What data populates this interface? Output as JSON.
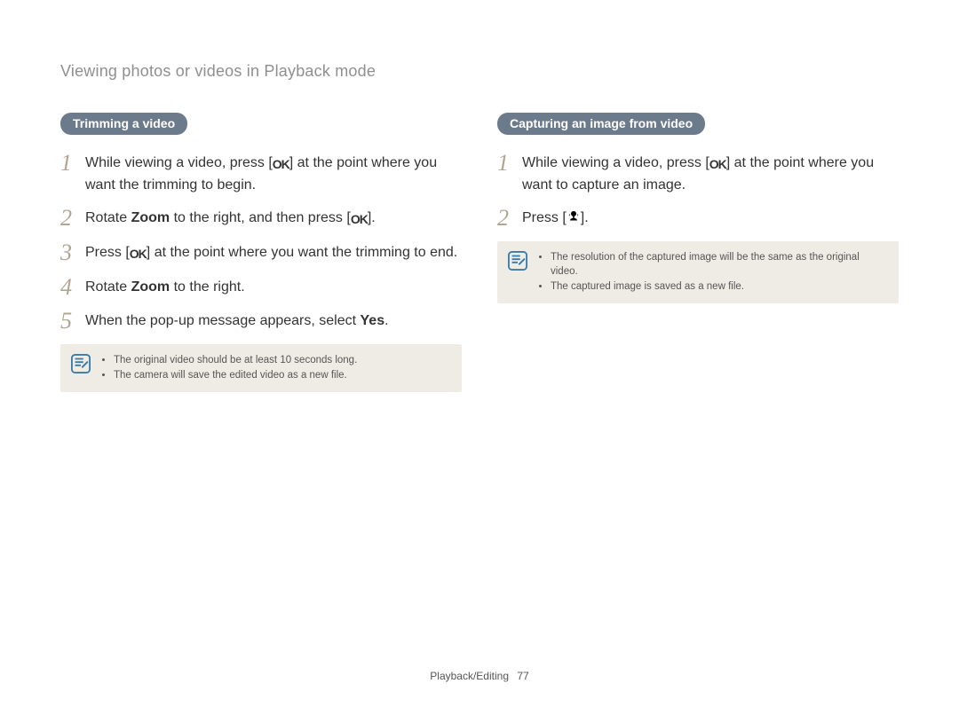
{
  "header": {
    "breadcrumb": "Viewing photos or videos in Playback mode"
  },
  "left": {
    "pill": "Trimming a video",
    "steps": [
      {
        "num": "1",
        "pre": "While viewing a video, press [",
        "icon": "ok",
        "post": "] at the point where you want the trimming to begin."
      },
      {
        "num": "2",
        "pre": "Rotate ",
        "bold": "Zoom",
        "mid": " to the right, and then press [",
        "icon": "ok",
        "post": "]."
      },
      {
        "num": "3",
        "pre": "Press [",
        "icon": "ok",
        "post": "] at the point where you want the trimming to end."
      },
      {
        "num": "4",
        "pre": "Rotate ",
        "bold": "Zoom",
        "post": " to the right."
      },
      {
        "num": "5",
        "pre": "When the pop-up message appears, select ",
        "bold": "Yes",
        "post": "."
      }
    ],
    "notes": [
      "The original video should be at least 10 seconds long.",
      "The camera will save the edited video as a new file."
    ]
  },
  "right": {
    "pill": "Capturing an image from video",
    "steps": [
      {
        "num": "1",
        "pre": "While viewing a video, press [",
        "icon": "ok",
        "post": "] at the point where you want to capture an image."
      },
      {
        "num": "2",
        "pre": "Press [",
        "icon": "macro",
        "post": "]."
      }
    ],
    "notes": [
      "The resolution of the captured image will be the same as the original video.",
      "The captured image is saved as a new file."
    ]
  },
  "footer": {
    "section": "Playback/Editing",
    "page": "77"
  }
}
